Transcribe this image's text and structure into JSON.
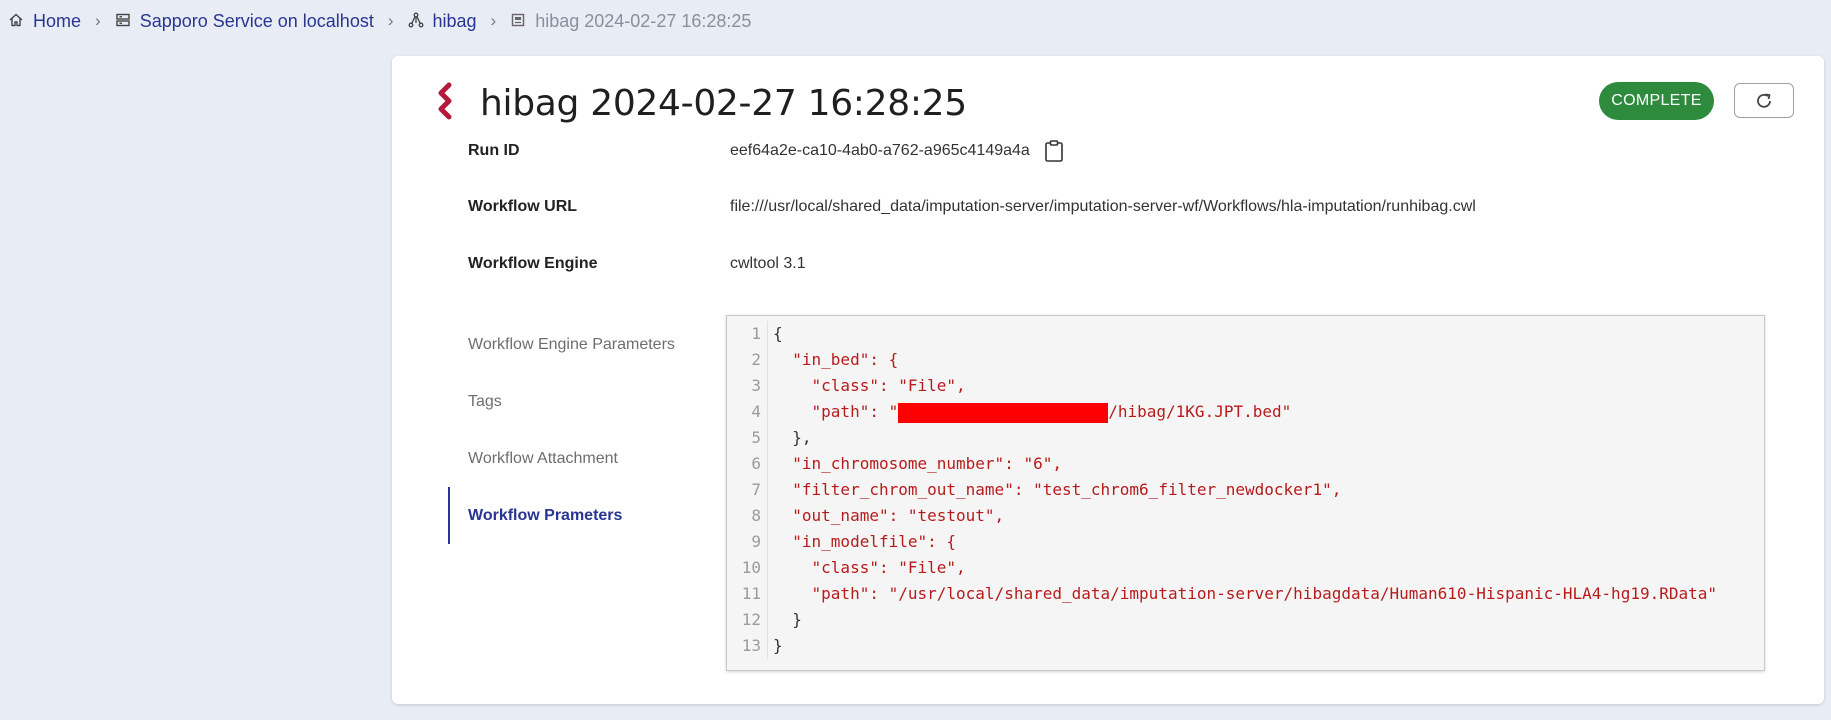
{
  "breadcrumb": {
    "home": "Home",
    "service": "Sapporo Service on localhost",
    "workflow": "hibag",
    "run": "hibag 2024-02-27 16:28:25"
  },
  "run": {
    "title": "hibag 2024-02-27 16:28:25",
    "status": "COMPLETE",
    "status_color": "#2e8b3e",
    "fields": {
      "run_id_label": "Run ID",
      "run_id_value": "eef64a2e-ca10-4ab0-a762-a965c4149a4a",
      "workflow_url_label": "Workflow URL",
      "workflow_url_value": "file:///usr/local/shared_data/imputation-server/imputation-server-wf/Workflows/hla-imputation/runhibag.cwl",
      "workflow_engine_label": "Workflow Engine",
      "workflow_engine_value": "cwltool 3.1"
    }
  },
  "tabs": [
    {
      "label": "Workflow Engine Parameters",
      "active": false
    },
    {
      "label": "Tags",
      "active": false
    },
    {
      "label": "Workflow Attachment",
      "active": false
    },
    {
      "label": "Workflow Prameters",
      "active": true
    }
  ],
  "code": {
    "line_numbers": [
      "1",
      "2",
      "3",
      "4",
      "5",
      "6",
      "7",
      "8",
      "9",
      "10",
      "11",
      "12",
      "13"
    ],
    "lines": [
      "{",
      "  \"in_bed\": {",
      "    \"class\": \"File\",",
      "    \"path\": \"",
      "/hibag/1KG.JPT.bed\"",
      "  },",
      "  \"in_chromosome_number\": \"6\",",
      "  \"filter_chrom_out_name\": \"test_chrom6_filter_newdocker1\",",
      "  \"out_name\": \"testout\",",
      "  \"in_modelfile\": {",
      "    \"class\": \"File\",",
      "    \"path\": \"/usr/local/shared_data/imputation-server/hibagdata/Human610-Hispanic-HLA4-hg19.RData\"",
      "  }",
      "}"
    ]
  },
  "icons": {
    "home": "home-icon",
    "service": "server-icon",
    "workflow": "workflow-icon",
    "run": "run-icon",
    "logo": "cwl-logo-icon",
    "refresh": "refresh-icon",
    "clipboard": "clipboard-icon"
  }
}
